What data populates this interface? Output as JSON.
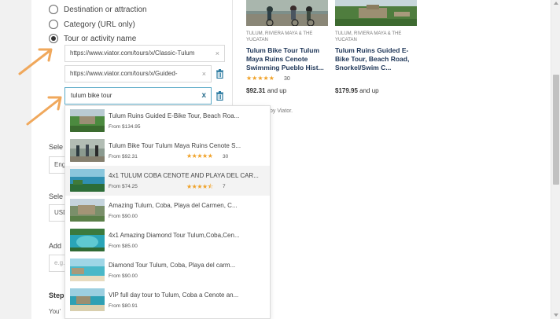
{
  "radios": [
    {
      "label": "Destination or attraction",
      "checked": false
    },
    {
      "label": "Category (URL only)",
      "checked": false
    },
    {
      "label": "Tour or activity name",
      "checked": true
    }
  ],
  "url_fields": [
    {
      "value": "https://www.viator.com/tours/x/Classic-Tulum",
      "clear": "×"
    },
    {
      "value": "https://www.viator.com/tours/x/Guided-",
      "clear": "×"
    }
  ],
  "search": {
    "value": "tulum bike tour",
    "clear": "x"
  },
  "dropdown": [
    {
      "title": "Tulum Ruins Guided E-Bike Tour, Beach Roa...",
      "price": "From $134.95",
      "stars": "",
      "count": ""
    },
    {
      "title": "Tulum Bike Tour Tulum Maya Ruins Cenote S...",
      "price": "From $92.31",
      "stars": "★★★★★",
      "count": "30"
    },
    {
      "title": "4x1 TULUM COBA CENOTE AND PLAYA DEL CAR...",
      "price": "From $74.25",
      "stars": "★★★★⯪",
      "count": "7"
    },
    {
      "title": "Amazing Tulum, Coba, Playa del Carmen, C...",
      "price": "From $90.00",
      "stars": "",
      "count": ""
    },
    {
      "title": "4x1 Amazing Diamond Tour Tulum,Coba,Cen...",
      "price": "From $85.00",
      "stars": "",
      "count": ""
    },
    {
      "title": "Diamond Tour Tulum, Coba, Playa del carm...",
      "price": "From $90.00",
      "stars": "",
      "count": ""
    },
    {
      "title": "VIP full day tour to Tulum, Coba a Cenote an...",
      "price": "From $80.91",
      "stars": "",
      "count": ""
    }
  ],
  "left_labels": {
    "select1": "Sele",
    "sel1_val": "Eng",
    "select2": "Sele",
    "sel2_val": "USD",
    "add": "Add",
    "add_val": "e.g.",
    "step": "Step",
    "you": "You'"
  },
  "cards": [
    {
      "loc": "TULUM, RIVIERA MAYA & THE YUCATAN",
      "title": "Tulum Bike Tour Tulum Maya Ruins Cenote Swimming Pueblo Hist...",
      "stars": "★★★★★",
      "count": "30",
      "price": "$92.31",
      "suffix": "and up"
    },
    {
      "loc": "TULUM, RIVIERA MAYA & THE YUCATAN",
      "title": "Tulum Ruins Guided E-Bike Tour, Beach Road, Snorkel/Swim C...",
      "stars": "",
      "count": "",
      "price": "$179.95",
      "suffix": "and up"
    }
  ],
  "powered_by": "by Viator."
}
